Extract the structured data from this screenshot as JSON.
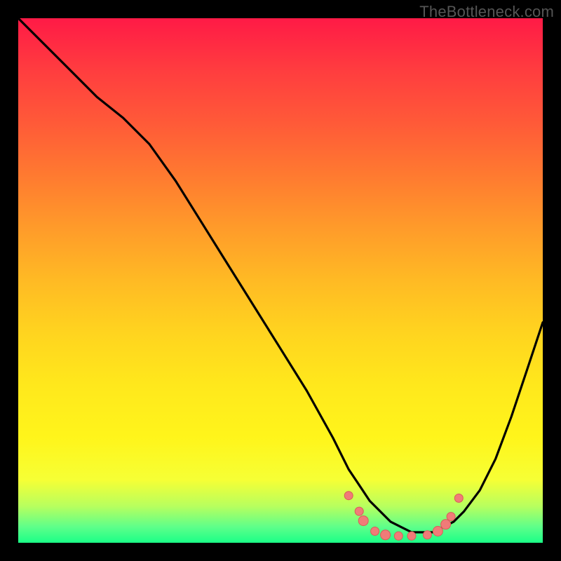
{
  "watermark": {
    "text": "TheBottleneck.com"
  },
  "colors": {
    "background": "#000000",
    "line": "#000000",
    "dot_fill": "#f07b78",
    "dot_stroke": "#d95c58"
  },
  "chart_data": {
    "type": "line",
    "title": "",
    "xlabel": "",
    "ylabel": "",
    "xlim": [
      0,
      100
    ],
    "ylim": [
      0,
      100
    ],
    "grid": false,
    "legend": false,
    "series": [
      {
        "name": "bottleneck-curve",
        "x": [
          0,
          5,
          10,
          15,
          20,
          25,
          30,
          35,
          40,
          45,
          50,
          55,
          60,
          63,
          65,
          67,
          69,
          71,
          73,
          75,
          77,
          79,
          81,
          83,
          85,
          88,
          91,
          94,
          97,
          100
        ],
        "y": [
          100,
          95,
          90,
          85,
          81,
          76,
          69,
          61,
          53,
          45,
          37,
          29,
          20,
          14,
          11,
          8,
          6,
          4,
          3,
          2,
          2,
          2,
          3,
          4,
          6,
          10,
          16,
          24,
          33,
          42
        ]
      }
    ],
    "dots": {
      "name": "near-minimum-dots",
      "points": [
        {
          "x": 63.0,
          "y": 9.0,
          "r": 6
        },
        {
          "x": 65.0,
          "y": 6.0,
          "r": 6
        },
        {
          "x": 65.8,
          "y": 4.2,
          "r": 7
        },
        {
          "x": 68.0,
          "y": 2.2,
          "r": 6
        },
        {
          "x": 70.0,
          "y": 1.5,
          "r": 7
        },
        {
          "x": 72.5,
          "y": 1.3,
          "r": 6
        },
        {
          "x": 75.0,
          "y": 1.3,
          "r": 6
        },
        {
          "x": 78.0,
          "y": 1.5,
          "r": 6
        },
        {
          "x": 80.0,
          "y": 2.2,
          "r": 7
        },
        {
          "x": 81.5,
          "y": 3.5,
          "r": 7
        },
        {
          "x": 82.5,
          "y": 5.0,
          "r": 6
        },
        {
          "x": 84.0,
          "y": 8.5,
          "r": 6
        }
      ]
    }
  }
}
